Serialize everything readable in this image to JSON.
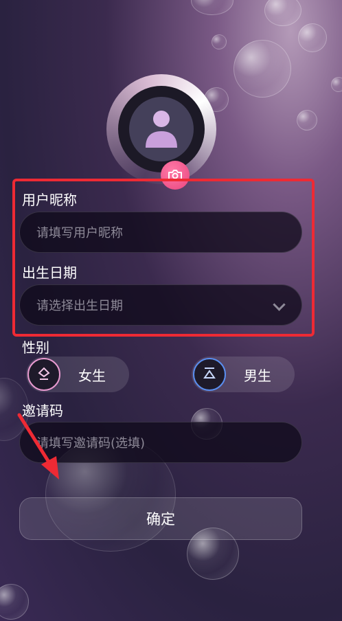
{
  "form": {
    "nickname_label": "用户昵称",
    "nickname_placeholder": "请填写用户昵称",
    "birthday_label": "出生日期",
    "birthday_placeholder": "请选择出生日期",
    "gender_label": "性别",
    "gender_female": "女生",
    "gender_male": "男生",
    "invite_label": "邀请码",
    "invite_placeholder": "请填写邀请码(选填)",
    "confirm_label": "确定"
  },
  "colors": {
    "highlight_frame": "#ee2a34",
    "camera_button": "#e8457e",
    "female_accent": "#e89ad0",
    "male_accent": "#5a8ef0",
    "annotation_arrow": "#ee2a34"
  },
  "icons": {
    "avatar": "user-placeholder-icon",
    "camera": "camera-icon",
    "female": "female-symbol-icon",
    "male": "male-symbol-icon",
    "select": "chevron-down-icon"
  }
}
